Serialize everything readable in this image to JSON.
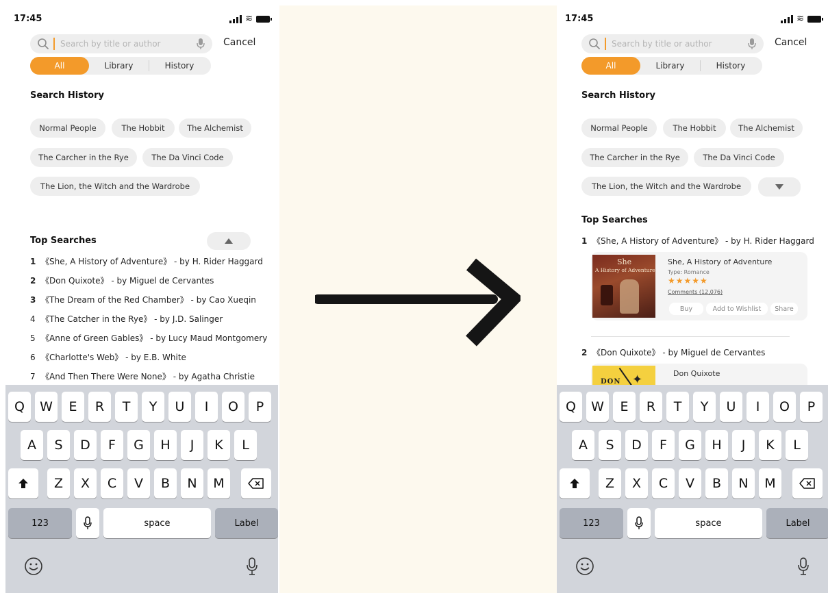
{
  "status": {
    "time": "17:45"
  },
  "search": {
    "placeholder": "Search by title or author",
    "cancel_label": "Cancel"
  },
  "segments": {
    "all": "All",
    "library": "Library",
    "history": "History"
  },
  "search_history": {
    "title": "Search History",
    "chips": [
      "Normal People",
      "The Hobbit",
      "The Alchemist",
      "The Carcher in the Rye",
      "The Da Vinci Code",
      "The Lion, the Witch and the Wardrobe"
    ]
  },
  "top_searches": {
    "title": "Top Searches",
    "items": [
      {
        "rank": "1",
        "text": "《She, A History of Adventure》 - by H. Rider Haggard"
      },
      {
        "rank": "2",
        "text": "《Don Quixote》 - by Miguel de Cervantes"
      },
      {
        "rank": "3",
        "text": "《The Dream of the Red Chamber》 - by Cao Xueqin"
      },
      {
        "rank": "4",
        "text": "《The Catcher in the Rye》 - by J.D. Salinger"
      },
      {
        "rank": "5",
        "text": "《Anne of Green Gables》 - by Lucy Maud Montgomery"
      },
      {
        "rank": "6",
        "text": "《Charlotte's Web》 - by E.B. White"
      },
      {
        "rank": "7",
        "text": "《And Then There Were None》 - by Agatha Christie"
      }
    ]
  },
  "book_card_1": {
    "cover_title": "She",
    "cover_subtitle": "A History of Adventure",
    "title": "She, A History of Adventure",
    "type": "Type: Romance",
    "stars": "★★★★★",
    "comments": "Comments (12,076)",
    "buy_label": "Buy",
    "wishlist_label": "Add to Wishlist",
    "share_label": "Share"
  },
  "book_card_2": {
    "cover_title": "DON",
    "title": "Don Quixote"
  },
  "keyboard": {
    "row1": [
      "Q",
      "W",
      "E",
      "R",
      "T",
      "Y",
      "U",
      "I",
      "O",
      "P"
    ],
    "row2": [
      "A",
      "S",
      "D",
      "F",
      "G",
      "H",
      "J",
      "K",
      "L"
    ],
    "row3": [
      "Z",
      "X",
      "C",
      "V",
      "B",
      "N",
      "M"
    ],
    "numbers_label": "123",
    "space_label": "space",
    "return_label": "Label"
  },
  "colors": {
    "accent": "#f39a2a",
    "chip_bg": "#eeeeee",
    "keyboard_bg": "#d2d5db",
    "divider_bg": "#fdf9ee"
  }
}
